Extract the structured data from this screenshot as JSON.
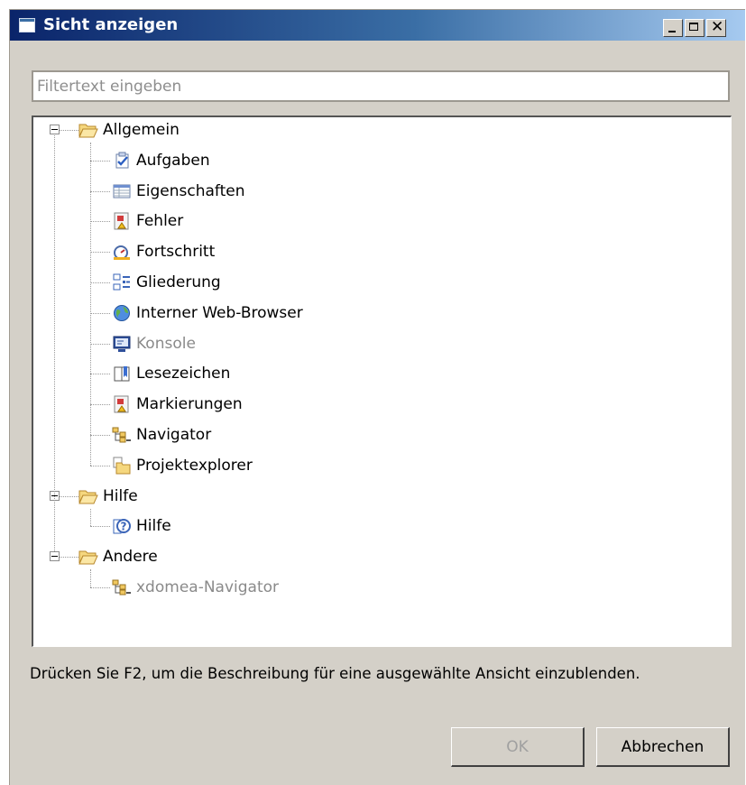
{
  "window": {
    "title": "Sicht anzeigen"
  },
  "filter": {
    "placeholder": "Filtertext eingeben",
    "value": ""
  },
  "tree": {
    "categories": [
      {
        "label": "Allgemein",
        "icon": "folder-open-icon",
        "expanded": true,
        "items": [
          {
            "label": "Aufgaben",
            "icon": "tasks-icon",
            "enabled": true
          },
          {
            "label": "Eigenschaften",
            "icon": "properties-icon",
            "enabled": true
          },
          {
            "label": "Fehler",
            "icon": "problems-icon",
            "enabled": true
          },
          {
            "label": "Fortschritt",
            "icon": "progress-icon",
            "enabled": true
          },
          {
            "label": "Gliederung",
            "icon": "outline-icon",
            "enabled": true
          },
          {
            "label": "Interner Web-Browser",
            "icon": "globe-icon",
            "enabled": true
          },
          {
            "label": "Konsole",
            "icon": "console-icon",
            "enabled": false
          },
          {
            "label": "Lesezeichen",
            "icon": "bookmarks-icon",
            "enabled": true
          },
          {
            "label": "Markierungen",
            "icon": "markers-icon",
            "enabled": true
          },
          {
            "label": "Navigator",
            "icon": "navigator-icon",
            "enabled": true
          },
          {
            "label": "Projektexplorer",
            "icon": "project-explorer-icon",
            "enabled": true
          }
        ]
      },
      {
        "label": "Hilfe",
        "icon": "folder-open-icon",
        "expanded": true,
        "items": [
          {
            "label": "Hilfe",
            "icon": "help-icon",
            "enabled": true
          }
        ]
      },
      {
        "label": "Andere",
        "icon": "folder-open-icon",
        "expanded": true,
        "items": [
          {
            "label": "xdomea-Navigator",
            "icon": "navigator-icon",
            "enabled": false
          }
        ]
      }
    ]
  },
  "hint": "Drücken Sie F2, um die Beschreibung für eine ausgewählte Ansicht einzublenden.",
  "buttons": {
    "ok": "OK",
    "ok_enabled": false,
    "cancel": "Abbrechen"
  },
  "colors": {
    "titlebar_start": "#0a246a",
    "titlebar_end": "#a6caf0",
    "dialog_bg": "#d4d0c8",
    "disabled_text": "#8a8a8a"
  }
}
